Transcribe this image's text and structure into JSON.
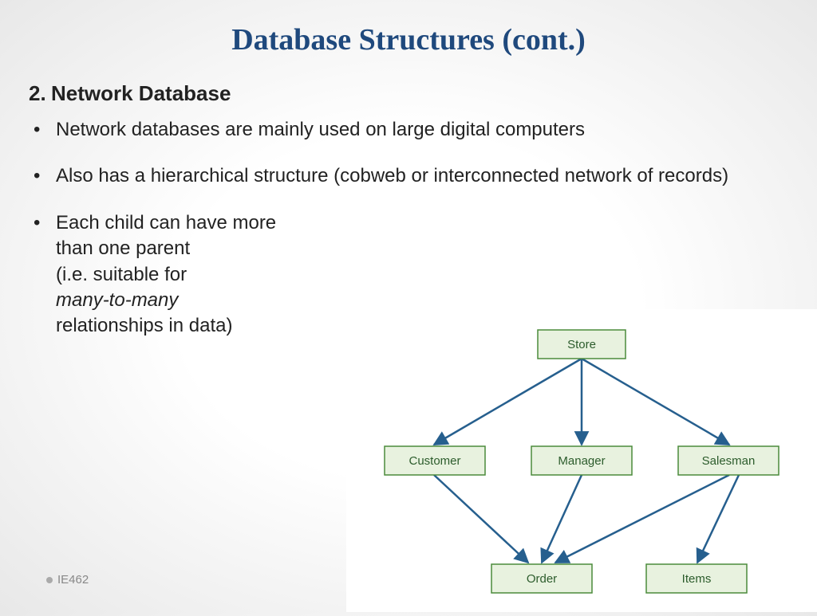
{
  "title": "Database Structures (cont.)",
  "section": {
    "number": "2.",
    "heading": "Network Database"
  },
  "bullets": [
    "Network databases are mainly used on large digital computers",
    "Also has a hierarchical structure (cobweb or interconnected network of records)",
    "Each child can have more than one parent (i.e. suitable for many-to-many relationships in data)"
  ],
  "bullet3": {
    "line1": "Each child can have more",
    "line2": "than one parent",
    "line3": "(i.e. suitable for",
    "italic": "many-to-many",
    "line5": "relationships in data)"
  },
  "footer": "IE462",
  "diagram": {
    "nodes": {
      "store": "Store",
      "customer": "Customer",
      "manager": "Manager",
      "salesman": "Salesman",
      "order": "Order",
      "items": "Items"
    },
    "edges": [
      [
        "store",
        "customer"
      ],
      [
        "store",
        "manager"
      ],
      [
        "store",
        "salesman"
      ],
      [
        "customer",
        "order"
      ],
      [
        "manager",
        "order"
      ],
      [
        "salesman",
        "order"
      ],
      [
        "salesman",
        "items"
      ]
    ]
  }
}
